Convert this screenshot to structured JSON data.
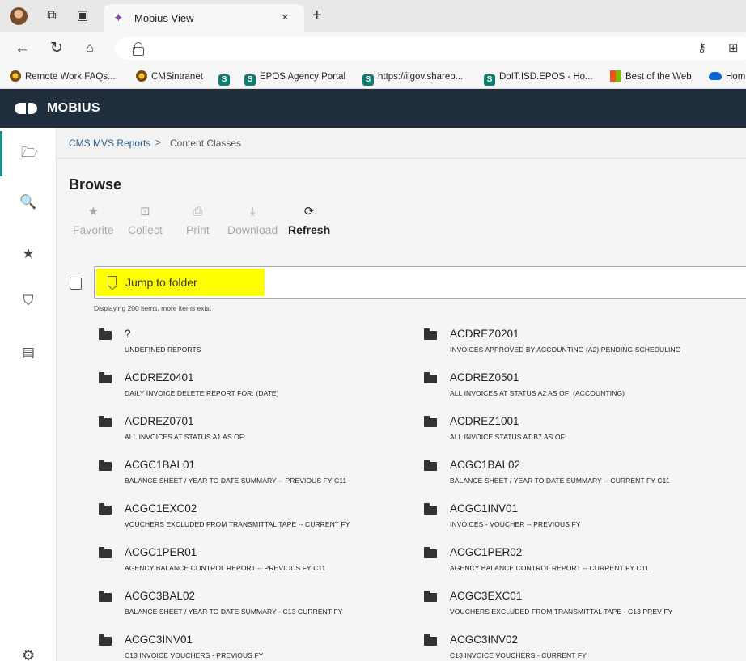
{
  "browser": {
    "tab_title": "Mobius View",
    "tab_close": "×",
    "new_tab": "+",
    "bookmarks": [
      {
        "label": "Remote Work FAQs...",
        "icon": "cms-logo-icon"
      },
      {
        "label": "CMSintranet",
        "icon": "cms-logo-icon"
      },
      {
        "label": "",
        "icon": "sharepoint-icon"
      },
      {
        "label": "EPOS Agency Portal",
        "icon": "sharepoint-icon"
      },
      {
        "label": "https://ilgov.sharep...",
        "icon": "sharepoint-icon"
      },
      {
        "label": "DoIT.ISD.EPOS - Ho...",
        "icon": "sharepoint-icon"
      },
      {
        "label": "Best of the Web",
        "icon": "microsoft-icon"
      },
      {
        "label": "Hom",
        "icon": "onedrive-icon"
      }
    ]
  },
  "app": {
    "brand": "MOBIUS"
  },
  "breadcrumb": {
    "root": "CMS MVS Reports",
    "separator": ">",
    "current": "Content Classes"
  },
  "page": {
    "title": "Browse",
    "toolbar": [
      {
        "label": "Favorite",
        "icon": "star-icon",
        "enabled": false
      },
      {
        "label": "Collect",
        "icon": "collect-icon",
        "enabled": false
      },
      {
        "label": "Print",
        "icon": "print-icon",
        "enabled": false
      },
      {
        "label": "Download",
        "icon": "download-icon",
        "enabled": false
      },
      {
        "label": "Refresh",
        "icon": "refresh-icon",
        "enabled": true
      }
    ],
    "jump_placeholder": "Jump to folder",
    "count_text": "Displaying 200 items, more items exist"
  },
  "items": [
    {
      "name": "?",
      "desc": "UNDEFINED REPORTS"
    },
    {
      "name": "ACDREZ0201",
      "desc": "INVOICES APPROVED BY ACCOUNTING (A2) PENDING SCHEDULING"
    },
    {
      "name": "ACDREZ0401",
      "desc": "DAILY INVOICE DELETE REPORT FOR: (DATE)"
    },
    {
      "name": "ACDREZ0501",
      "desc": "ALL INVOICES AT STATUS A2 AS OF: (ACCOUNTING)"
    },
    {
      "name": "ACDREZ0701",
      "desc": "ALL INVOICES AT STATUS A1 AS OF:"
    },
    {
      "name": "ACDREZ1001",
      "desc": "ALL INVOICE STATUS AT B7 AS OF:"
    },
    {
      "name": "ACGC1BAL01",
      "desc": "BALANCE SHEET / YEAR TO DATE SUMMARY -- PREVIOUS FY C11"
    },
    {
      "name": "ACGC1BAL02",
      "desc": "BALANCE SHEET / YEAR TO DATE SUMMARY -- CURRENT FY C11"
    },
    {
      "name": "ACGC1EXC02",
      "desc": "VOUCHERS EXCLUDED FROM TRANSMITTAL TAPE -- CURRENT FY"
    },
    {
      "name": "ACGC1INV01",
      "desc": "INVOICES - VOUCHER -- PREVIOUS FY"
    },
    {
      "name": "ACGC1PER01",
      "desc": "AGENCY BALANCE CONTROL REPORT -- PREVIOUS FY C11"
    },
    {
      "name": "ACGC1PER02",
      "desc": "AGENCY BALANCE CONTROL REPORT -- CURRENT FY C11"
    },
    {
      "name": "ACGC3BAL02",
      "desc": "BALANCE SHEET / YEAR TO DATE SUMMARY - C13 CURRENT FY"
    },
    {
      "name": "ACGC3EXC01",
      "desc": "VOUCHERS EXCLUDED FROM TRANSMITTAL TAPE - C13 PREV FY"
    },
    {
      "name": "ACGC3INV01",
      "desc": "C13 INVOICE VOUCHERS - PREVIOUS FY"
    },
    {
      "name": "ACGC3INV02",
      "desc": "C13 INVOICE VOUCHERS - CURRENT FY"
    }
  ]
}
